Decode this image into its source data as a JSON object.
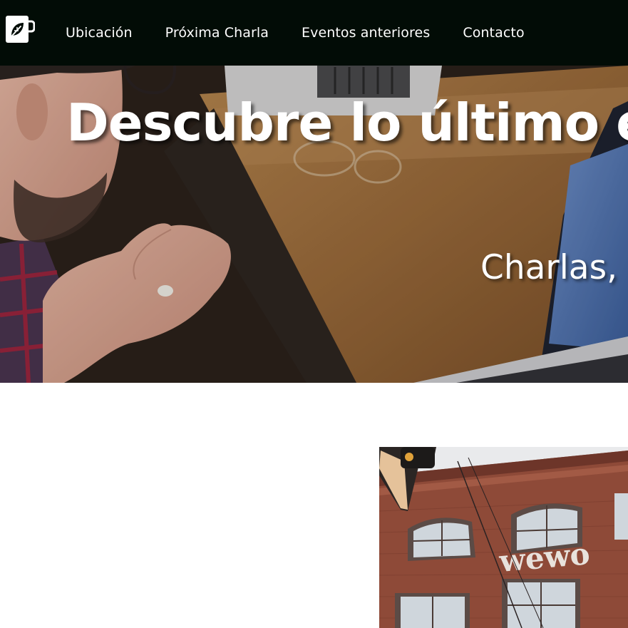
{
  "nav": {
    "logo_icon": "mug-leaf-icon",
    "links": [
      {
        "label": "Ubicación"
      },
      {
        "label": "Próxima Charla"
      },
      {
        "label": "Eventos anteriores"
      },
      {
        "label": "Contacto"
      }
    ]
  },
  "hero": {
    "title": "Descubre lo último e",
    "subtitle": "Charlas, c"
  },
  "building": {
    "sign_text": "wewo"
  },
  "colors": {
    "nav_bg": "#020c06",
    "text": "#ffffff"
  }
}
